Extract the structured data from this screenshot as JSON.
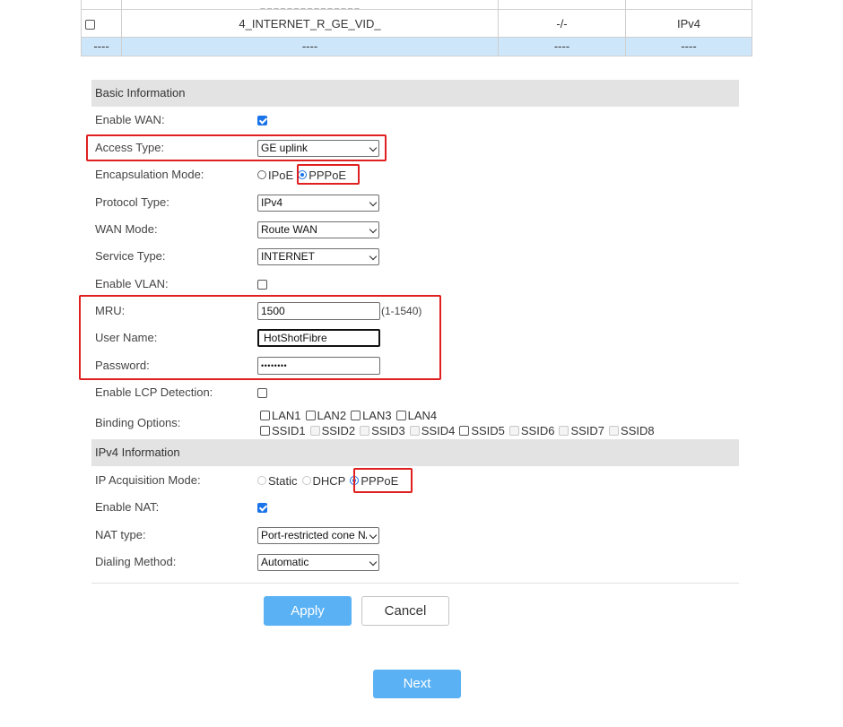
{
  "wan_table": {
    "partial_row": [
      "",
      "_ _ _ _ _ _ _ _ _ _ _ _ _ _ _",
      "",
      ""
    ],
    "row": {
      "name": "4_INTERNET_R_GE_VID_",
      "vlan": "-/-",
      "protocol": "IPv4"
    },
    "empty_row": [
      "----",
      "----",
      "----",
      "----"
    ]
  },
  "basic_info": {
    "title": "Basic Information",
    "enable_wan": {
      "label": "Enable WAN:",
      "checked": true
    },
    "access_type": {
      "label": "Access Type:",
      "value": "GE uplink"
    },
    "encapsulation": {
      "label": "Encapsulation Mode:",
      "options": [
        "IPoE",
        "PPPoE"
      ],
      "selected": "PPPoE"
    },
    "protocol_type": {
      "label": "Protocol Type:",
      "value": "IPv4"
    },
    "wan_mode": {
      "label": "WAN Mode:",
      "value": "Route WAN"
    },
    "service_type": {
      "label": "Service Type:",
      "value": "INTERNET"
    },
    "enable_vlan": {
      "label": "Enable VLAN:",
      "checked": false
    },
    "mru": {
      "label": "MRU:",
      "value": "1500",
      "hint": "(1-1540)"
    },
    "user_name": {
      "label": "User Name:",
      "value": "HotShotFibre"
    },
    "password": {
      "label": "Password:",
      "value": "••••••••"
    },
    "enable_lcp": {
      "label": "Enable LCP Detection:",
      "checked": false
    },
    "binding": {
      "label": "Binding Options:",
      "lan": [
        "LAN1",
        "LAN2",
        "LAN3",
        "LAN4"
      ],
      "ssid": [
        "SSID1",
        "SSID2",
        "SSID3",
        "SSID4",
        "SSID5",
        "SSID6",
        "SSID7",
        "SSID8"
      ]
    }
  },
  "ipv4_info": {
    "title": "IPv4 Information",
    "ip_mode": {
      "label": "IP Acquisition Mode:",
      "options": [
        "Static",
        "DHCP",
        "PPPoE"
      ],
      "selected": "PPPoE"
    },
    "enable_nat": {
      "label": "Enable NAT:",
      "checked": true
    },
    "nat_type": {
      "label": "NAT type:",
      "value": "Port-restricted cone NAT"
    },
    "dialing_method": {
      "label": "Dialing Method:",
      "value": "Automatic"
    }
  },
  "buttons": {
    "apply": "Apply",
    "cancel": "Cancel",
    "next": "Next"
  },
  "colors": {
    "accent": "#5ab2f5",
    "highlight_box": "#e02020",
    "section_bg": "#e3e3e3",
    "table_empty_row": "#cde6fa"
  }
}
